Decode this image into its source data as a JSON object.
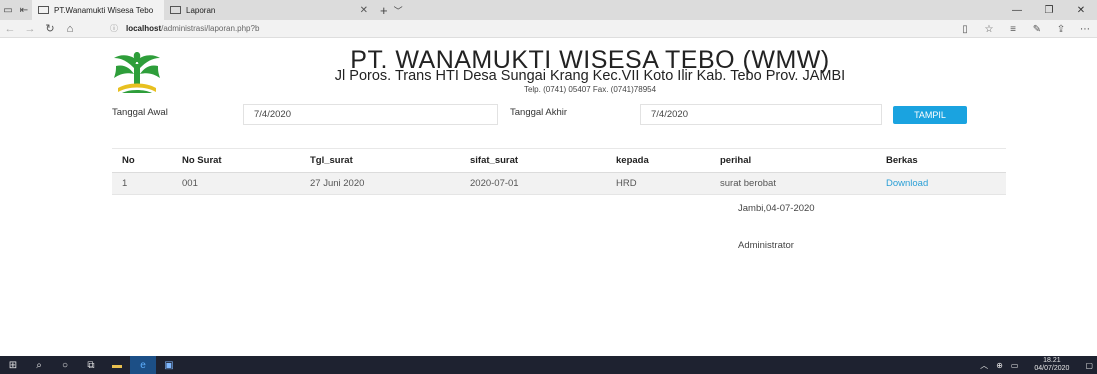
{
  "browser": {
    "tabs": [
      {
        "label": "PT.Wanamukti Wisesa Tebo",
        "active": true
      },
      {
        "label": "Laporan",
        "active": false
      }
    ],
    "url_host": "localhost",
    "url_path": "/administrasi/laporan.php?b"
  },
  "header": {
    "company_title": "PT. WANAMUKTI WISESA TEBO (WMW)",
    "address": "Jl Poros. Trans HTI Desa Sungai Krang Kec.VII Koto Ilir Kab. Tebo Prov. JAMBI",
    "phone": "Telp. (0741) 05407 Fax. (0741)78954"
  },
  "filter": {
    "start_label": "Tanggal Awal",
    "start_value": "7/4/2020",
    "end_label": "Tanggal Akhir",
    "end_value": "7/4/2020",
    "submit_label": "TAMPIL"
  },
  "table": {
    "headers": [
      "No",
      "No Surat",
      "Tgl_surat",
      "sifat_surat",
      "kepada",
      "perihal",
      "Berkas"
    ],
    "rows": [
      {
        "no": "1",
        "no_surat": "001",
        "tgl_surat": "27 Juni 2020",
        "sifat_surat": "2020-07-01",
        "kepada": "HRD",
        "perihal": "surat berobat",
        "berkas": "Download"
      }
    ]
  },
  "signature": {
    "place_date": "Jambi,04-07-2020",
    "name": "Administrator"
  },
  "taskbar": {
    "time": "18.21",
    "date": "04/07/2020"
  },
  "colors": {
    "accent": "#1aa3e0",
    "link": "#2a9fd6",
    "logo_green": "#2e9e3a",
    "logo_yellow": "#e8c020"
  }
}
